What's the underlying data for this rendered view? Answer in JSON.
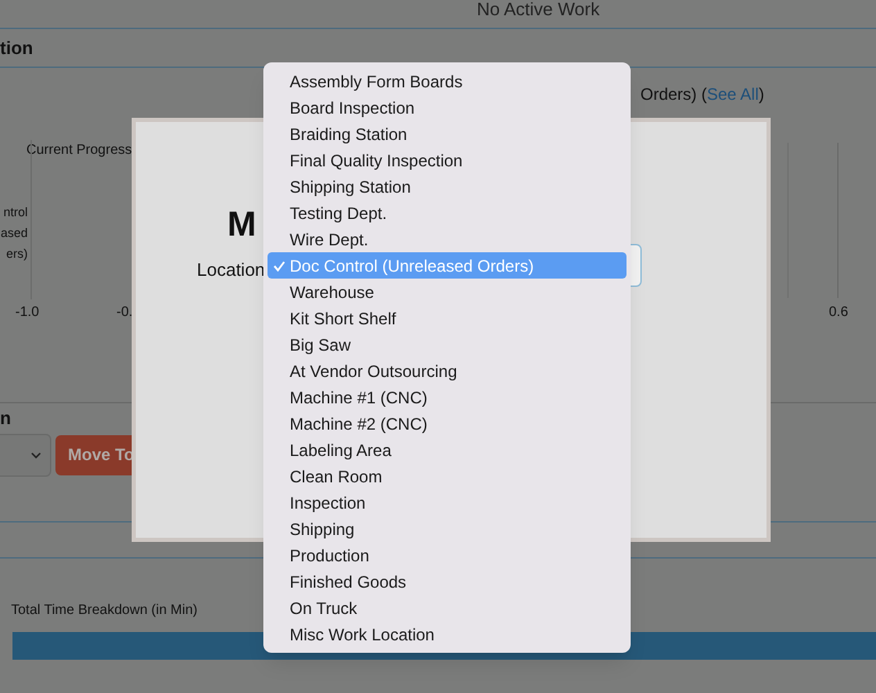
{
  "header": {
    "status": "No Active Work"
  },
  "section_title": "tion",
  "progress": {
    "title": "Current Progress",
    "summary_text": "Orders) (",
    "see_all_link": "See All",
    "summary_end": ")",
    "row_label_lines": [
      "ntrol",
      "ased",
      "ers)"
    ],
    "ticks": [
      "-1.0",
      "-0.",
      "0.6"
    ]
  },
  "move_section": {
    "title": "n",
    "button": "Move To"
  },
  "breakdown": {
    "title": "Total Time Breakdown (in Min)"
  },
  "modal": {
    "heading": "M",
    "location_label": "Location"
  },
  "location_menu": [
    {
      "label": "Assembly Form Boards",
      "selected": false
    },
    {
      "label": "Board Inspection",
      "selected": false
    },
    {
      "label": "Braiding Station",
      "selected": false
    },
    {
      "label": "Final Quality Inspection",
      "selected": false
    },
    {
      "label": "Shipping Station",
      "selected": false
    },
    {
      "label": "Testing Dept.",
      "selected": false
    },
    {
      "label": "Wire Dept.",
      "selected": false
    },
    {
      "label": "Doc Control (Unreleased Orders)",
      "selected": true
    },
    {
      "label": "Warehouse",
      "selected": false
    },
    {
      "label": "Kit Short Shelf",
      "selected": false
    },
    {
      "label": "Big Saw",
      "selected": false
    },
    {
      "label": "At Vendor Outsourcing",
      "selected": false
    },
    {
      "label": "Machine #1 (CNC)",
      "selected": false
    },
    {
      "label": "Machine #2 (CNC)",
      "selected": false
    },
    {
      "label": "Labeling Area",
      "selected": false
    },
    {
      "label": "Clean Room",
      "selected": false
    },
    {
      "label": "Inspection",
      "selected": false
    },
    {
      "label": "Shipping",
      "selected": false
    },
    {
      "label": "Production",
      "selected": false
    },
    {
      "label": "Finished Goods",
      "selected": false
    },
    {
      "label": "On Truck",
      "selected": false
    },
    {
      "label": "Misc Work Location",
      "selected": false
    }
  ]
}
